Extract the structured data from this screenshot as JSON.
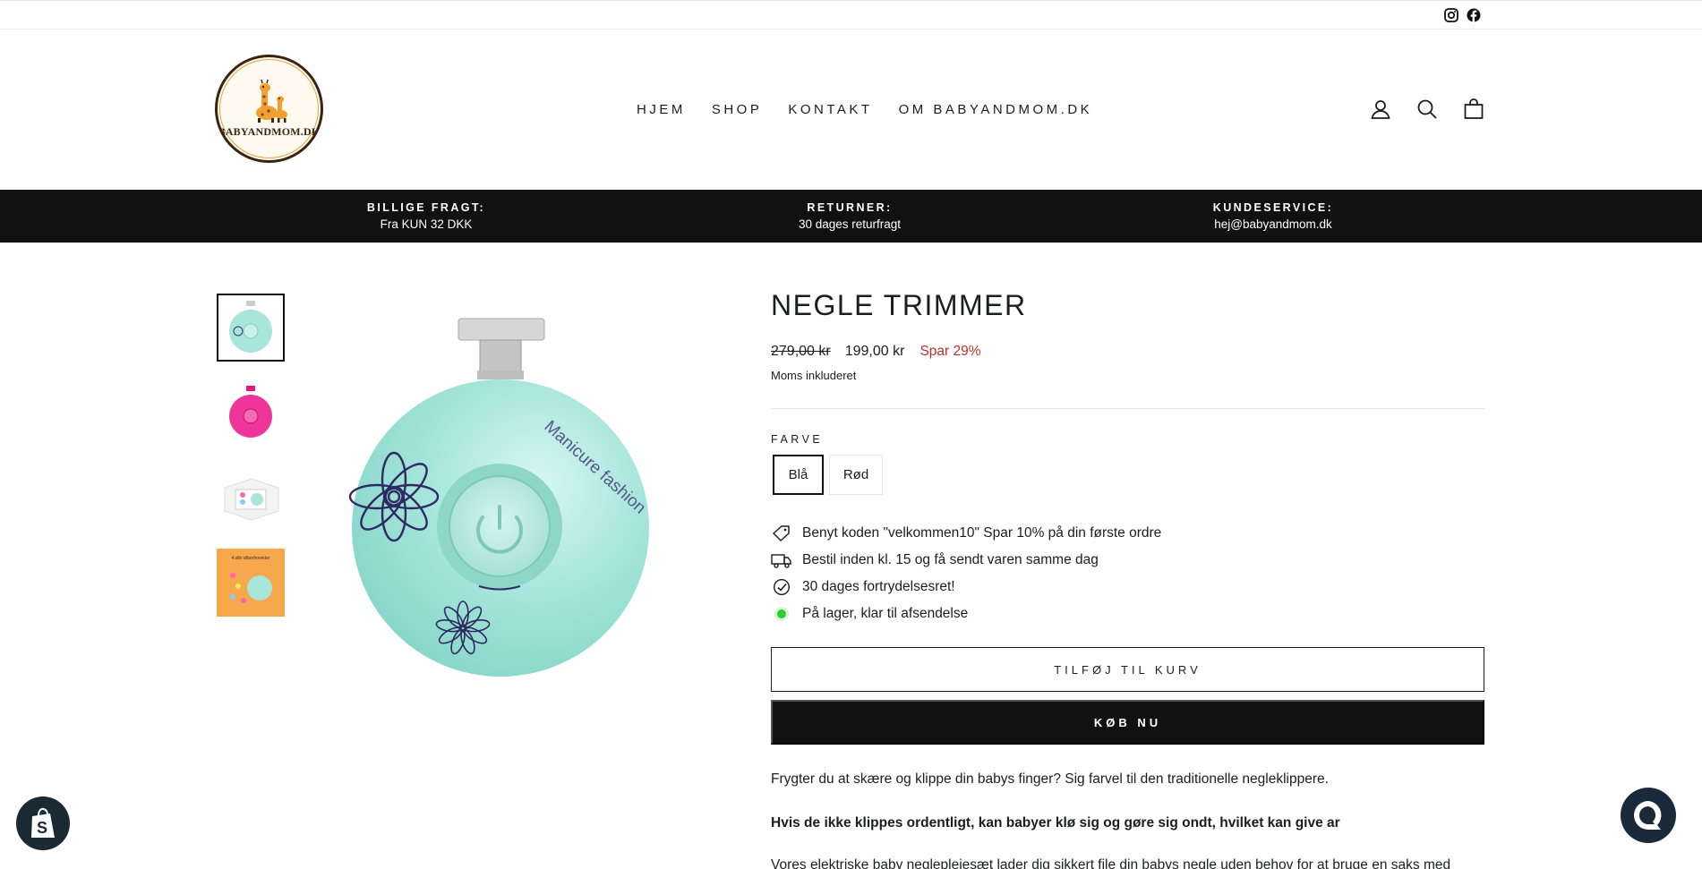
{
  "topbar": {
    "social": [
      {
        "name": "instagram-icon"
      },
      {
        "name": "facebook-icon"
      }
    ]
  },
  "header": {
    "logo_text": "BABYANDMOM.DK",
    "nav": [
      "HJEM",
      "SHOP",
      "KONTAKT",
      "OM BABYANDMOM.DK"
    ],
    "icons": [
      "account-icon",
      "search-icon",
      "cart-icon"
    ]
  },
  "announcement": [
    {
      "title": "BILLIGE FRAGT:",
      "text": "Fra KUN 32 DKK"
    },
    {
      "title": "RETURNER:",
      "text": "30 dages returfragt"
    },
    {
      "title": "KUNDESERVICE:",
      "text": "hej@babyandmom.dk"
    }
  ],
  "gallery": {
    "main_image_text": "Manicure fashion",
    "thumbnail_caption": "4 slib sliberhoveder"
  },
  "product": {
    "title": "NEGLE TRIMMER",
    "old_price": "279,00 kr",
    "price": "199,00 kr",
    "save": "Spar 29%",
    "tax_note": "Moms inkluderet",
    "option_label": "FARVE",
    "options": [
      "Blå",
      "Rød"
    ],
    "selected_option": "Blå",
    "features": [
      "Benyt koden \"velkommen10\" Spar 10% på din første ordre",
      "Bestil inden kl. 15 og få sendt varen samme dag",
      "30 dages fortrydelsesret!",
      "På lager, klar til afsendelse"
    ],
    "add_to_cart": "TILFØJ TIL KURV",
    "buy_now": "KØB NU",
    "description": [
      "Frygter du at skære og klippe din babys finger? Sig farvel til den traditionelle negleklippere.",
      "Hvis de ikke klippes ordentligt, kan babyer klø sig og gøre sig ondt, hvilket kan give ar",
      "Vores elektriske baby negleplejesæt lader dig sikkert file din babys negle uden behov for at bruge en saks med"
    ]
  },
  "colors": {
    "accent": "#111111",
    "sale": "#b8322f",
    "stock": "#2ecc2e",
    "product_body": "#a8e6dc"
  }
}
